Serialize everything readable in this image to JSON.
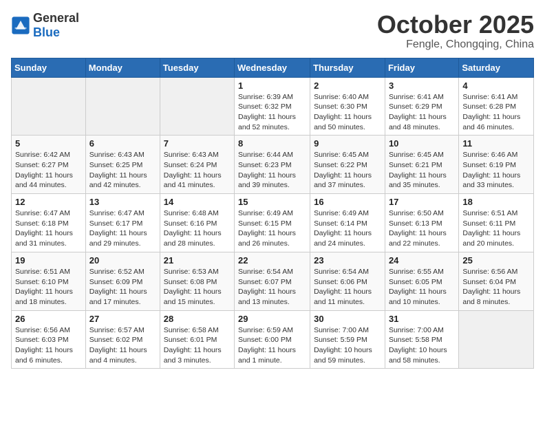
{
  "logo": {
    "general": "General",
    "blue": "Blue"
  },
  "header": {
    "title": "October 2025",
    "subtitle": "Fengle, Chongqing, China"
  },
  "weekdays": [
    "Sunday",
    "Monday",
    "Tuesday",
    "Wednesday",
    "Thursday",
    "Friday",
    "Saturday"
  ],
  "weeks": [
    [
      {
        "day": "",
        "info": ""
      },
      {
        "day": "",
        "info": ""
      },
      {
        "day": "",
        "info": ""
      },
      {
        "day": "1",
        "info": "Sunrise: 6:39 AM\nSunset: 6:32 PM\nDaylight: 11 hours\nand 52 minutes."
      },
      {
        "day": "2",
        "info": "Sunrise: 6:40 AM\nSunset: 6:30 PM\nDaylight: 11 hours\nand 50 minutes."
      },
      {
        "day": "3",
        "info": "Sunrise: 6:41 AM\nSunset: 6:29 PM\nDaylight: 11 hours\nand 48 minutes."
      },
      {
        "day": "4",
        "info": "Sunrise: 6:41 AM\nSunset: 6:28 PM\nDaylight: 11 hours\nand 46 minutes."
      }
    ],
    [
      {
        "day": "5",
        "info": "Sunrise: 6:42 AM\nSunset: 6:27 PM\nDaylight: 11 hours\nand 44 minutes."
      },
      {
        "day": "6",
        "info": "Sunrise: 6:43 AM\nSunset: 6:25 PM\nDaylight: 11 hours\nand 42 minutes."
      },
      {
        "day": "7",
        "info": "Sunrise: 6:43 AM\nSunset: 6:24 PM\nDaylight: 11 hours\nand 41 minutes."
      },
      {
        "day": "8",
        "info": "Sunrise: 6:44 AM\nSunset: 6:23 PM\nDaylight: 11 hours\nand 39 minutes."
      },
      {
        "day": "9",
        "info": "Sunrise: 6:45 AM\nSunset: 6:22 PM\nDaylight: 11 hours\nand 37 minutes."
      },
      {
        "day": "10",
        "info": "Sunrise: 6:45 AM\nSunset: 6:21 PM\nDaylight: 11 hours\nand 35 minutes."
      },
      {
        "day": "11",
        "info": "Sunrise: 6:46 AM\nSunset: 6:19 PM\nDaylight: 11 hours\nand 33 minutes."
      }
    ],
    [
      {
        "day": "12",
        "info": "Sunrise: 6:47 AM\nSunset: 6:18 PM\nDaylight: 11 hours\nand 31 minutes."
      },
      {
        "day": "13",
        "info": "Sunrise: 6:47 AM\nSunset: 6:17 PM\nDaylight: 11 hours\nand 29 minutes."
      },
      {
        "day": "14",
        "info": "Sunrise: 6:48 AM\nSunset: 6:16 PM\nDaylight: 11 hours\nand 28 minutes."
      },
      {
        "day": "15",
        "info": "Sunrise: 6:49 AM\nSunset: 6:15 PM\nDaylight: 11 hours\nand 26 minutes."
      },
      {
        "day": "16",
        "info": "Sunrise: 6:49 AM\nSunset: 6:14 PM\nDaylight: 11 hours\nand 24 minutes."
      },
      {
        "day": "17",
        "info": "Sunrise: 6:50 AM\nSunset: 6:13 PM\nDaylight: 11 hours\nand 22 minutes."
      },
      {
        "day": "18",
        "info": "Sunrise: 6:51 AM\nSunset: 6:11 PM\nDaylight: 11 hours\nand 20 minutes."
      }
    ],
    [
      {
        "day": "19",
        "info": "Sunrise: 6:51 AM\nSunset: 6:10 PM\nDaylight: 11 hours\nand 18 minutes."
      },
      {
        "day": "20",
        "info": "Sunrise: 6:52 AM\nSunset: 6:09 PM\nDaylight: 11 hours\nand 17 minutes."
      },
      {
        "day": "21",
        "info": "Sunrise: 6:53 AM\nSunset: 6:08 PM\nDaylight: 11 hours\nand 15 minutes."
      },
      {
        "day": "22",
        "info": "Sunrise: 6:54 AM\nSunset: 6:07 PM\nDaylight: 11 hours\nand 13 minutes."
      },
      {
        "day": "23",
        "info": "Sunrise: 6:54 AM\nSunset: 6:06 PM\nDaylight: 11 hours\nand 11 minutes."
      },
      {
        "day": "24",
        "info": "Sunrise: 6:55 AM\nSunset: 6:05 PM\nDaylight: 11 hours\nand 10 minutes."
      },
      {
        "day": "25",
        "info": "Sunrise: 6:56 AM\nSunset: 6:04 PM\nDaylight: 11 hours\nand 8 minutes."
      }
    ],
    [
      {
        "day": "26",
        "info": "Sunrise: 6:56 AM\nSunset: 6:03 PM\nDaylight: 11 hours\nand 6 minutes."
      },
      {
        "day": "27",
        "info": "Sunrise: 6:57 AM\nSunset: 6:02 PM\nDaylight: 11 hours\nand 4 minutes."
      },
      {
        "day": "28",
        "info": "Sunrise: 6:58 AM\nSunset: 6:01 PM\nDaylight: 11 hours\nand 3 minutes."
      },
      {
        "day": "29",
        "info": "Sunrise: 6:59 AM\nSunset: 6:00 PM\nDaylight: 11 hours\nand 1 minute."
      },
      {
        "day": "30",
        "info": "Sunrise: 7:00 AM\nSunset: 5:59 PM\nDaylight: 10 hours\nand 59 minutes."
      },
      {
        "day": "31",
        "info": "Sunrise: 7:00 AM\nSunset: 5:58 PM\nDaylight: 10 hours\nand 58 minutes."
      },
      {
        "day": "",
        "info": ""
      }
    ]
  ]
}
